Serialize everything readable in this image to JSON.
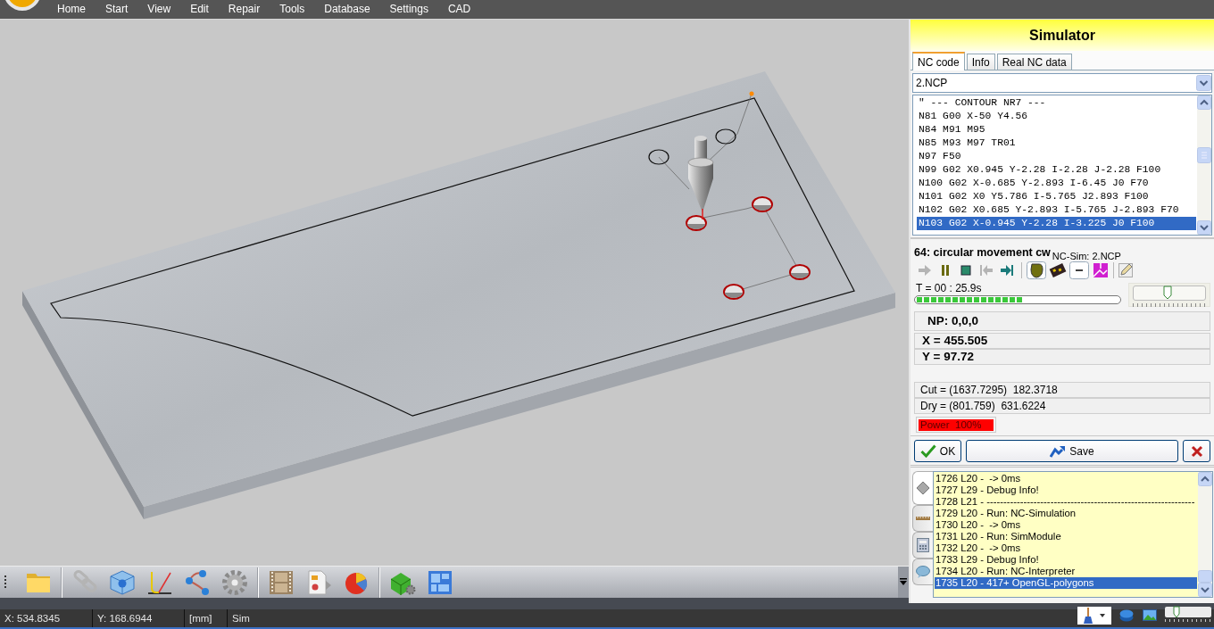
{
  "menu": [
    "Home",
    "Start",
    "View",
    "Edit",
    "Repair",
    "Tools",
    "Database",
    "Settings",
    "CAD"
  ],
  "simulator": {
    "title": "Simulator",
    "tabs": [
      {
        "label": "NC code",
        "selected": true
      },
      {
        "label": "Info",
        "selected": false
      },
      {
        "label": "Real NC data",
        "selected": false
      }
    ],
    "program_select": {
      "value": "2.NCP"
    },
    "code_lines": [
      {
        "text": "\" --- CONTOUR NR7 ---",
        "selected": false
      },
      {
        "text": "N81 G00 X-50 Y4.56",
        "selected": false
      },
      {
        "text": "N84 M91 M95",
        "selected": false
      },
      {
        "text": "N85 M93 M97 TR01",
        "selected": false
      },
      {
        "text": "N97 F50",
        "selected": false
      },
      {
        "text": "N99 G02 X0.945 Y-2.28 I-2.28 J-2.28 F100",
        "selected": false
      },
      {
        "text": "N100 G02 X-0.685 Y-2.893 I-6.45 J0 F70",
        "selected": false
      },
      {
        "text": "N101 G02 X0 Y5.786 I-5.765 J2.893 F100",
        "selected": false
      },
      {
        "text": "N102 G02 X0.685 Y-2.893 I-5.765 J-2.893 F70",
        "selected": false
      },
      {
        "text": "N103 G02 X-0.945 Y-2.28 I-3.225 J0 F100",
        "selected": true
      }
    ],
    "current_block": "64:  circular movement cw",
    "caption": "NC-Sim: 2.NCP",
    "controls": [
      {
        "kind": "play",
        "disabled": true
      },
      {
        "kind": "pause",
        "disabled": false
      },
      {
        "kind": "stop",
        "disabled": false
      },
      {
        "kind": "step_back",
        "disabled": true
      },
      {
        "kind": "step_end",
        "disabled": false
      }
    ],
    "view_toggles": [
      {
        "kind": "solid",
        "on": true
      },
      {
        "kind": "chip",
        "on": false
      },
      {
        "kind": "line",
        "on": true
      },
      {
        "kind": "mesh",
        "on": false
      }
    ],
    "time": "T =  00 : 25.9s",
    "progress": {
      "level": 0.53
    },
    "speed": {
      "level": 0.47
    },
    "np": "NP: 0,0,0",
    "x": "X = 455.505",
    "y": "Y = 97.72",
    "cut": "Cut = (1637.7295)  182.3718",
    "dry": "Dry = (801.759)  631.6224",
    "power": {
      "label": "Power  100%",
      "level": 1
    },
    "ok_button": "OK",
    "save_button": "Save"
  },
  "log": {
    "tabs": [
      {
        "kind": "eraser",
        "selected": true
      },
      {
        "kind": "ruler",
        "selected": false
      },
      {
        "kind": "calculator",
        "selected": false
      },
      {
        "kind": "chat",
        "selected": false
      }
    ],
    "lines": [
      {
        "text": "1726 L20 -  -> 0ms",
        "selected": false
      },
      {
        "text": "1727 L29 - Debug Info!",
        "selected": false
      },
      {
        "text": "1728 L21 - --------------------------------------------------------------",
        "selected": false
      },
      {
        "text": "1729 L20 - Run: NC-Simulation",
        "selected": false
      },
      {
        "text": "1730 L20 -  -> 0ms",
        "selected": false
      },
      {
        "text": "1731 L20 - Run: SimModule",
        "selected": false
      },
      {
        "text": "1732 L20 -  -> 0ms",
        "selected": false
      },
      {
        "text": "1733 L29 - Debug Info!",
        "selected": false
      },
      {
        "text": "1734 L20 - Run: NC-Interpreter",
        "selected": false
      },
      {
        "text": "1735 L20 - 417+ OpenGL-polygons",
        "selected": true
      }
    ]
  },
  "status_bar": {
    "x": "X: 534.8345",
    "y": "Y: 168.6944",
    "unit": "[mm]",
    "mode": "Sim",
    "zoom": {
      "level": 0.25
    }
  }
}
